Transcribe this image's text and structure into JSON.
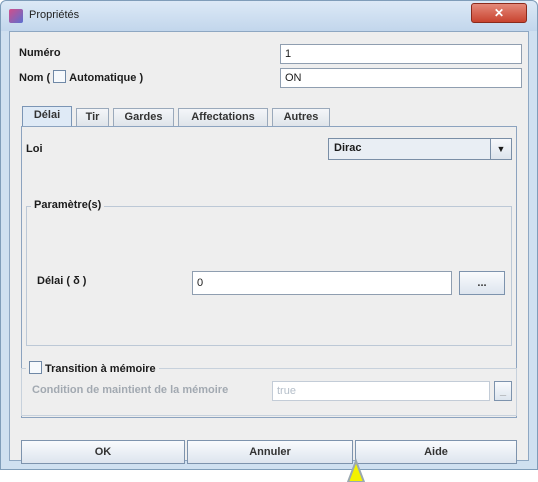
{
  "window": {
    "title": "Propriétés",
    "close_label": "✕"
  },
  "form": {
    "numero_label": "Numéro",
    "numero_value": "1",
    "nom_label_prefix": "Nom (",
    "nom_label_auto": "Automatique )",
    "nom_value": "ON"
  },
  "tabs": [
    {
      "label": "Délai",
      "active": true
    },
    {
      "label": "Tir"
    },
    {
      "label": "Gardes"
    },
    {
      "label": "Affectations"
    },
    {
      "label": "Autres"
    }
  ],
  "delai_tab": {
    "loi_label": "Loi",
    "loi_value": "Dirac",
    "parametres_legend": "Paramètre(s)",
    "delai_label": "Délai ( δ )",
    "delai_value": "0",
    "ellipsis_label": "..."
  },
  "transition": {
    "checkbox_label": "Transition à mémoire",
    "condition_label": "Condition de maintient de la mémoire",
    "condition_value": "true"
  },
  "buttons": {
    "ok": "OK",
    "cancel": "Annuler",
    "help": "Aide"
  }
}
